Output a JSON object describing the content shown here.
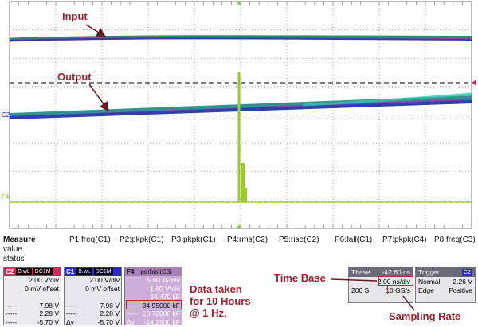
{
  "annotations": {
    "input_label": "Input",
    "output_label": "Output",
    "data_note_l1": "Data taken",
    "data_note_l2": "for 10 Hours",
    "data_note_l3": "@ 1 Hz.",
    "time_base": "Time Base",
    "sampling_rate": "Sampling Rate"
  },
  "markers": {
    "c2": "C2",
    "f4": "F4"
  },
  "measure": {
    "title": "Measure",
    "value_label": "value",
    "status_label": "status",
    "columns": [
      "P1:freq(C1)",
      "P2:pkpk(C1)",
      "P3:pkpk(C1)",
      "P4:rms(C2)",
      "P5:rise(C2)",
      "P6:fall(C1)",
      "P7:pkpk(C4)",
      "P8:freq(C3)"
    ]
  },
  "channels": [
    {
      "id": "C2",
      "tags": [
        "DC1M",
        "B.wL"
      ],
      "color": "#cc2a5a",
      "rows": [
        "2.00 V/div",
        "0 mV offset",
        "",
        "7.98 V",
        "2.28 V",
        "-5.70 V"
      ],
      "prefix": [
        "",
        "",
        "",
        "-----",
        "-----",
        "-----"
      ]
    },
    {
      "id": "C1",
      "tags": [
        "DC1M",
        "B.wL"
      ],
      "color": "#2a2ac8",
      "rows": [
        "2.00 V/div",
        "0 mV offset",
        "",
        "7.98 V",
        "2.28 V",
        "-5.70 V"
      ],
      "prefix": [
        "",
        "",
        "",
        "-----",
        "-----",
        "Δy"
      ]
    },
    {
      "id": "F4",
      "tags": [
        "perhist(C3)"
      ],
      "color": "#8ac43c",
      "rows": [
        "5.00 kF/div",
        "1.60 V/div",
        "34.470 kF",
        "34.95000 kF",
        "20.70000 kF",
        "-14.2500 kF"
      ],
      "prefix": [
        "",
        "",
        "",
        "-----",
        "-----",
        "Δy"
      ]
    }
  ],
  "timebase": {
    "title": "Tbase",
    "offset": "-42.60 ns",
    "div": "2.00 ns/div",
    "samples": "200 S",
    "rate": "10 GS/s"
  },
  "trigger": {
    "title": "Trigger",
    "channel": "C2",
    "mode": "Normal",
    "level": "2.26 V",
    "type": "Edge",
    "slope": "Positive"
  },
  "colors": {
    "grid": "#7a7a7a",
    "input_trace": "#3a3a9a",
    "output_trace": "#2f3fb0",
    "histogram": "#9ccc2c",
    "annotation": "#a51e2a",
    "arrow": "#6b1820"
  }
}
